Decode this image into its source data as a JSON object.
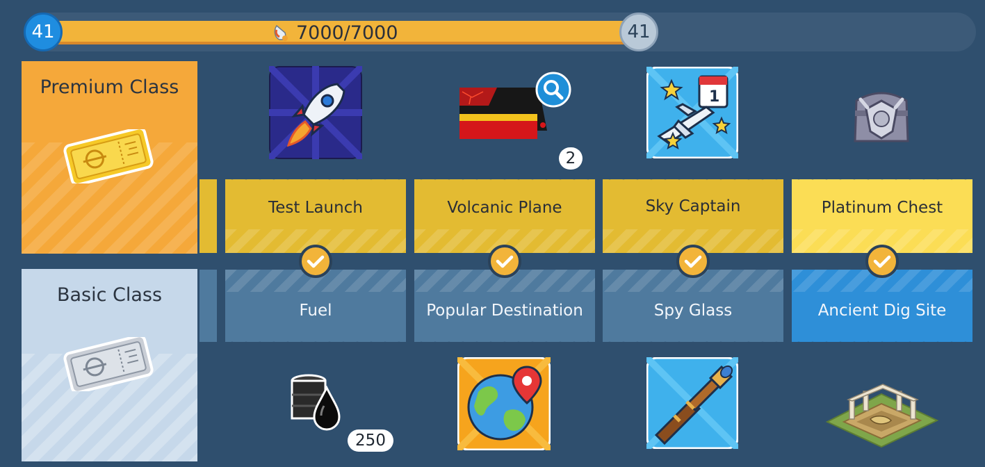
{
  "progress": {
    "level_current": "41",
    "level_next": "41",
    "points_text": "7000/7000",
    "icon": "fuel-icon",
    "fraction": 1.0
  },
  "classes": {
    "premium": {
      "label": "Premium Class",
      "icon": "gold-ticket-icon"
    },
    "basic": {
      "label": "Basic Class",
      "icon": "silver-ticket-icon"
    }
  },
  "premium_rewards": [
    {
      "label": "Test Launch",
      "icon": "rocket-icon",
      "claimed": true
    },
    {
      "label": "Volcanic Plane",
      "icon": "volcanic-plane-icon",
      "count": "2",
      "claimed": true
    },
    {
      "label": "Sky Captain",
      "icon": "sky-captain-icon",
      "claimed": true
    },
    {
      "label": "Platinum Chest",
      "icon": "platinum-chest-icon",
      "claimed": true
    }
  ],
  "basic_rewards": [
    {
      "label": "Fuel",
      "icon": "oil-barrel-icon",
      "count": "250",
      "claimed": true
    },
    {
      "label": "Popular Destination",
      "icon": "globe-pin-icon",
      "claimed": true
    },
    {
      "label": "Spy Glass",
      "icon": "spyglass-icon",
      "claimed": true
    },
    {
      "label": "Ancient Dig Site",
      "icon": "dig-site-icon",
      "claimed": true
    }
  ],
  "colors": {
    "background": "#2f4f6e",
    "progress_fill": "#f2b43a",
    "premium": "#f5a83a",
    "basic": "#c6d8ea",
    "gold_card": "#e3bb32",
    "basic_card": "#4f7a9e",
    "basic_card_active": "#2e8fd8"
  }
}
